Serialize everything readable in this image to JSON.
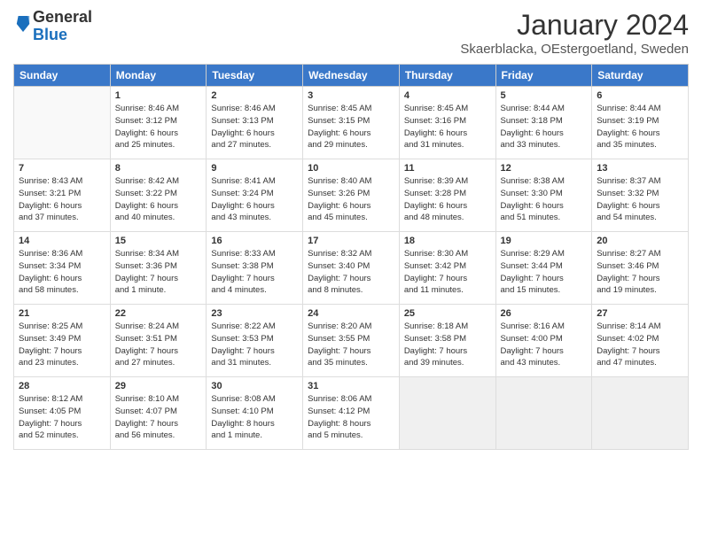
{
  "header": {
    "logo_line1": "General",
    "logo_line2": "Blue",
    "month": "January 2024",
    "location": "Skaerblacka, OEstergoetland, Sweden"
  },
  "days_of_week": [
    "Sunday",
    "Monday",
    "Tuesday",
    "Wednesday",
    "Thursday",
    "Friday",
    "Saturday"
  ],
  "weeks": [
    [
      {
        "day": "",
        "info": ""
      },
      {
        "day": "1",
        "info": "Sunrise: 8:46 AM\nSunset: 3:12 PM\nDaylight: 6 hours\nand 25 minutes."
      },
      {
        "day": "2",
        "info": "Sunrise: 8:46 AM\nSunset: 3:13 PM\nDaylight: 6 hours\nand 27 minutes."
      },
      {
        "day": "3",
        "info": "Sunrise: 8:45 AM\nSunset: 3:15 PM\nDaylight: 6 hours\nand 29 minutes."
      },
      {
        "day": "4",
        "info": "Sunrise: 8:45 AM\nSunset: 3:16 PM\nDaylight: 6 hours\nand 31 minutes."
      },
      {
        "day": "5",
        "info": "Sunrise: 8:44 AM\nSunset: 3:18 PM\nDaylight: 6 hours\nand 33 minutes."
      },
      {
        "day": "6",
        "info": "Sunrise: 8:44 AM\nSunset: 3:19 PM\nDaylight: 6 hours\nand 35 minutes."
      }
    ],
    [
      {
        "day": "7",
        "info": "Sunrise: 8:43 AM\nSunset: 3:21 PM\nDaylight: 6 hours\nand 37 minutes."
      },
      {
        "day": "8",
        "info": "Sunrise: 8:42 AM\nSunset: 3:22 PM\nDaylight: 6 hours\nand 40 minutes."
      },
      {
        "day": "9",
        "info": "Sunrise: 8:41 AM\nSunset: 3:24 PM\nDaylight: 6 hours\nand 43 minutes."
      },
      {
        "day": "10",
        "info": "Sunrise: 8:40 AM\nSunset: 3:26 PM\nDaylight: 6 hours\nand 45 minutes."
      },
      {
        "day": "11",
        "info": "Sunrise: 8:39 AM\nSunset: 3:28 PM\nDaylight: 6 hours\nand 48 minutes."
      },
      {
        "day": "12",
        "info": "Sunrise: 8:38 AM\nSunset: 3:30 PM\nDaylight: 6 hours\nand 51 minutes."
      },
      {
        "day": "13",
        "info": "Sunrise: 8:37 AM\nSunset: 3:32 PM\nDaylight: 6 hours\nand 54 minutes."
      }
    ],
    [
      {
        "day": "14",
        "info": "Sunrise: 8:36 AM\nSunset: 3:34 PM\nDaylight: 6 hours\nand 58 minutes."
      },
      {
        "day": "15",
        "info": "Sunrise: 8:34 AM\nSunset: 3:36 PM\nDaylight: 7 hours\nand 1 minute."
      },
      {
        "day": "16",
        "info": "Sunrise: 8:33 AM\nSunset: 3:38 PM\nDaylight: 7 hours\nand 4 minutes."
      },
      {
        "day": "17",
        "info": "Sunrise: 8:32 AM\nSunset: 3:40 PM\nDaylight: 7 hours\nand 8 minutes."
      },
      {
        "day": "18",
        "info": "Sunrise: 8:30 AM\nSunset: 3:42 PM\nDaylight: 7 hours\nand 11 minutes."
      },
      {
        "day": "19",
        "info": "Sunrise: 8:29 AM\nSunset: 3:44 PM\nDaylight: 7 hours\nand 15 minutes."
      },
      {
        "day": "20",
        "info": "Sunrise: 8:27 AM\nSunset: 3:46 PM\nDaylight: 7 hours\nand 19 minutes."
      }
    ],
    [
      {
        "day": "21",
        "info": "Sunrise: 8:25 AM\nSunset: 3:49 PM\nDaylight: 7 hours\nand 23 minutes."
      },
      {
        "day": "22",
        "info": "Sunrise: 8:24 AM\nSunset: 3:51 PM\nDaylight: 7 hours\nand 27 minutes."
      },
      {
        "day": "23",
        "info": "Sunrise: 8:22 AM\nSunset: 3:53 PM\nDaylight: 7 hours\nand 31 minutes."
      },
      {
        "day": "24",
        "info": "Sunrise: 8:20 AM\nSunset: 3:55 PM\nDaylight: 7 hours\nand 35 minutes."
      },
      {
        "day": "25",
        "info": "Sunrise: 8:18 AM\nSunset: 3:58 PM\nDaylight: 7 hours\nand 39 minutes."
      },
      {
        "day": "26",
        "info": "Sunrise: 8:16 AM\nSunset: 4:00 PM\nDaylight: 7 hours\nand 43 minutes."
      },
      {
        "day": "27",
        "info": "Sunrise: 8:14 AM\nSunset: 4:02 PM\nDaylight: 7 hours\nand 47 minutes."
      }
    ],
    [
      {
        "day": "28",
        "info": "Sunrise: 8:12 AM\nSunset: 4:05 PM\nDaylight: 7 hours\nand 52 minutes."
      },
      {
        "day": "29",
        "info": "Sunrise: 8:10 AM\nSunset: 4:07 PM\nDaylight: 7 hours\nand 56 minutes."
      },
      {
        "day": "30",
        "info": "Sunrise: 8:08 AM\nSunset: 4:10 PM\nDaylight: 8 hours\nand 1 minute."
      },
      {
        "day": "31",
        "info": "Sunrise: 8:06 AM\nSunset: 4:12 PM\nDaylight: 8 hours\nand 5 minutes."
      },
      {
        "day": "",
        "info": ""
      },
      {
        "day": "",
        "info": ""
      },
      {
        "day": "",
        "info": ""
      }
    ]
  ]
}
